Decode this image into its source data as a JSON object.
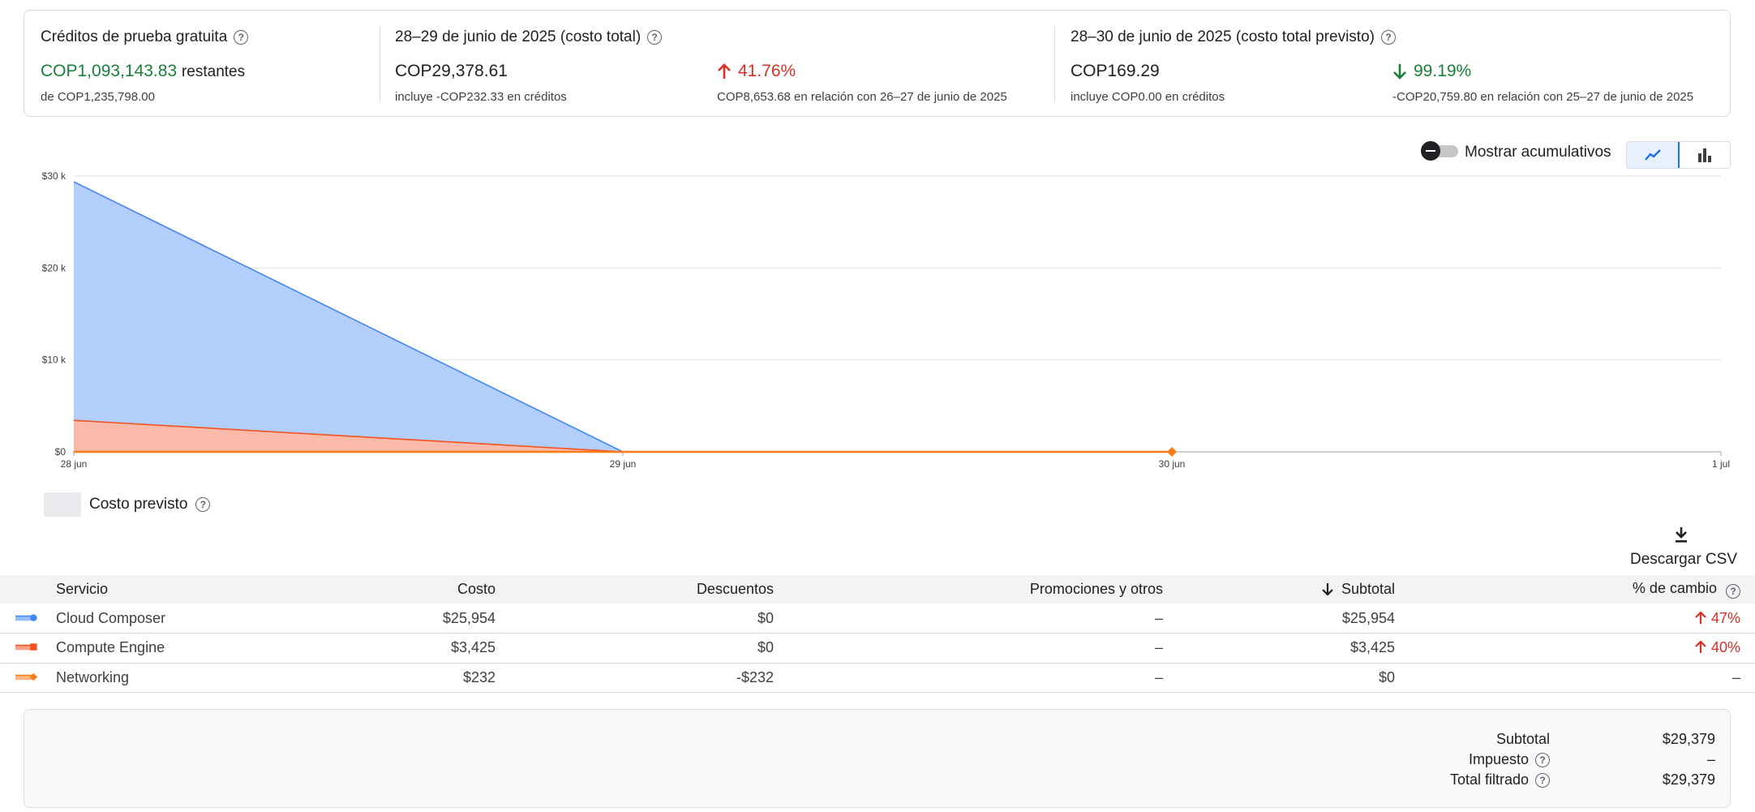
{
  "summary": {
    "credits": {
      "title": "Créditos de prueba gratuita",
      "amount": "COP1,093,143.83",
      "amount_suffix": "restantes",
      "of_total": "de COP1,235,798.00"
    },
    "total_cost": {
      "title": "28–29 de junio de 2025 (costo total)",
      "amount": "COP29,378.61",
      "credits_note": "incluye -COP232.33 en créditos",
      "change_pct": "41.76%",
      "change_note": "COP8,653.68 en relación con 26–27 de junio de 2025"
    },
    "forecast": {
      "title": "28–30 de junio de 2025 (costo total previsto)",
      "amount": "COP169.29",
      "credits_note": "incluye COP0.00 en créditos",
      "change_pct": "99.19%",
      "change_note": "-COP20,759.80 en relación con 25–27 de junio de 2025"
    }
  },
  "toolbar": {
    "cumulative_label": "Mostrar acumulativos",
    "cumulative_on": false,
    "chart_mode": "line"
  },
  "chart_data": {
    "type": "area",
    "x": [
      "28 jun",
      "29 jun",
      "30 jun",
      "1 jul"
    ],
    "y_ticks": [
      "$0",
      "$10 k",
      "$20 k",
      "$30 k"
    ],
    "ylim": [
      0,
      30000
    ],
    "grid": true,
    "series": [
      {
        "name": "Cloud Composer",
        "color": "#4285f4",
        "fill": "#aecbfa",
        "values": [
          25954,
          0,
          0
        ]
      },
      {
        "name": "Compute Engine",
        "color": "#f4511e",
        "fill": "#fdb8a4",
        "values": [
          3425,
          0,
          0
        ]
      },
      {
        "name": "Networking",
        "color": "#fa7b17",
        "values": [
          0,
          0,
          0
        ]
      }
    ],
    "stacked": true,
    "forecast_marker_x": "30 jun"
  },
  "legend": {
    "forecast_label": "Costo previsto"
  },
  "download": {
    "label": "Descargar CSV"
  },
  "table": {
    "headers": {
      "service": "Servicio",
      "cost": "Costo",
      "discounts": "Descuentos",
      "promotions": "Promociones y otros",
      "subtotal": "Subtotal",
      "change": "% de cambio"
    },
    "rows": [
      {
        "service": "Cloud Composer",
        "cost": "$25,954",
        "discounts": "$0",
        "promotions": "–",
        "subtotal": "$25,954",
        "change": "47%",
        "trend": "up",
        "color": "#4285f4",
        "marker": "circle"
      },
      {
        "service": "Compute Engine",
        "cost": "$3,425",
        "discounts": "$0",
        "promotions": "–",
        "subtotal": "$3,425",
        "change": "40%",
        "trend": "up",
        "color": "#f4511e",
        "marker": "square"
      },
      {
        "service": "Networking",
        "cost": "$232",
        "discounts": "-$232",
        "promotions": "–",
        "subtotal": "$0",
        "change": "–",
        "trend": "none",
        "color": "#fa7b17",
        "marker": "diamond"
      }
    ]
  },
  "totals": {
    "subtotal_label": "Subtotal",
    "subtotal_value": "$29,379",
    "tax_label": "Impuesto",
    "tax_value": "–",
    "filtered_label": "Total filtrado",
    "filtered_value": "$29,379"
  }
}
